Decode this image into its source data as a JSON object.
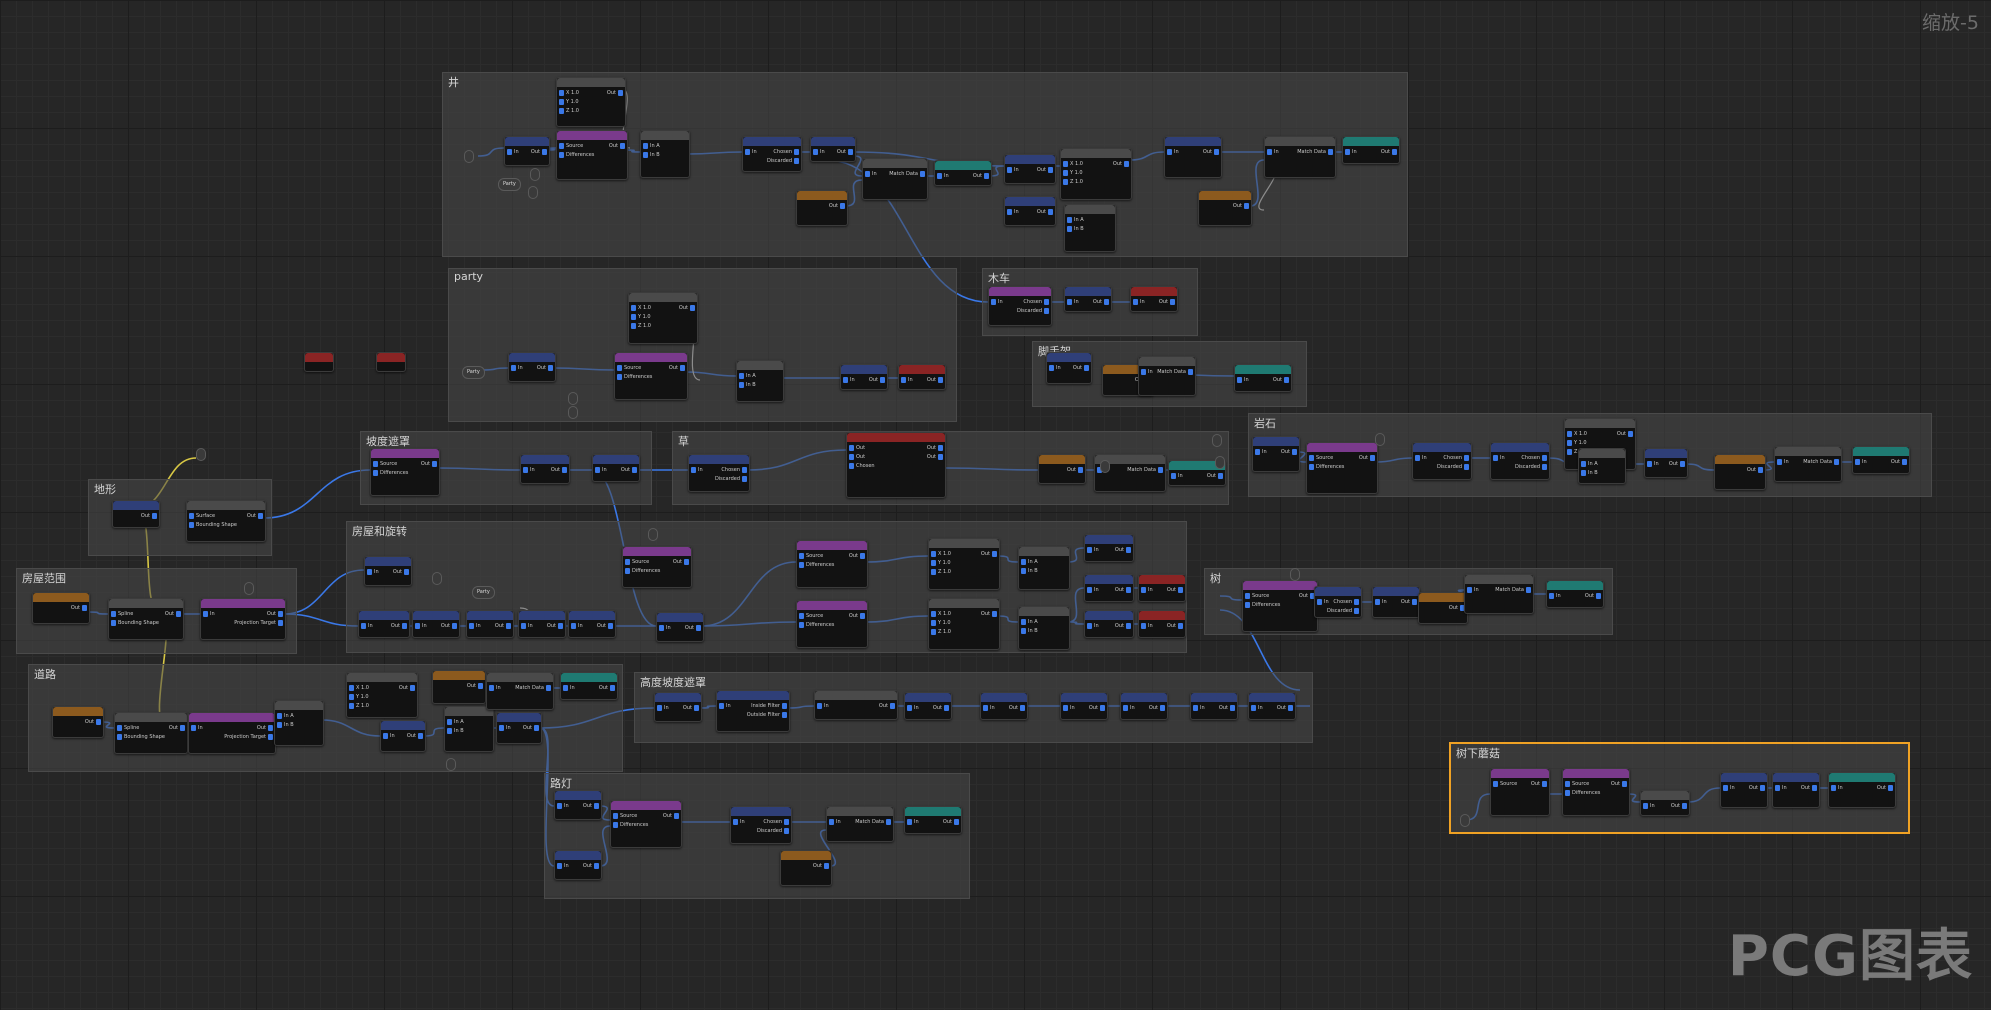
{
  "viewport": {
    "zoom_label": "缩放-5"
  },
  "watermark": "PCG图表",
  "groups": {
    "well": "井",
    "party": "party",
    "cart": "木车",
    "scaffold": "脚手架",
    "rock": "岩石",
    "terrain": "地形",
    "slope_mask": "坡度遮罩",
    "grass": "草",
    "house_pos_rot": "房屋和旋转",
    "house_range": "房屋范围",
    "tree": "树",
    "road": "道路",
    "height_slope_mask": "高度坡度遮罩",
    "streetlamp": "路灯",
    "under_tree": "树下蘑菇"
  },
  "labels": {
    "source": "Source",
    "differences": "Differences",
    "in": "In",
    "out": "Out",
    "in_a": "In A",
    "in_b": "In B",
    "chosen": "Chosen",
    "discarded": "Discarded",
    "match_data": "Match Data",
    "surface": "Surface",
    "bounding_shape": "Bounding Shape",
    "spline": "Spline",
    "projection_target": "Projection Target",
    "inside_filter": "Inside Filter",
    "outside_filter": "Outside Filter",
    "x": "X 1.0",
    "y": "Y 1.0",
    "z": "Z 1.0",
    "party": "Party"
  },
  "colors": {
    "wire": "#3a78e8",
    "wire_yellow": "#d8c845",
    "wire_white": "#dddddd",
    "header_purple": "#7a3a8c",
    "header_blue": "#2f3f78",
    "header_teal": "#1f7a72",
    "header_red": "#8a2424",
    "header_orange": "#8c5a1e",
    "header_gray": "#4a4a4a",
    "selection": "#f0a224"
  }
}
